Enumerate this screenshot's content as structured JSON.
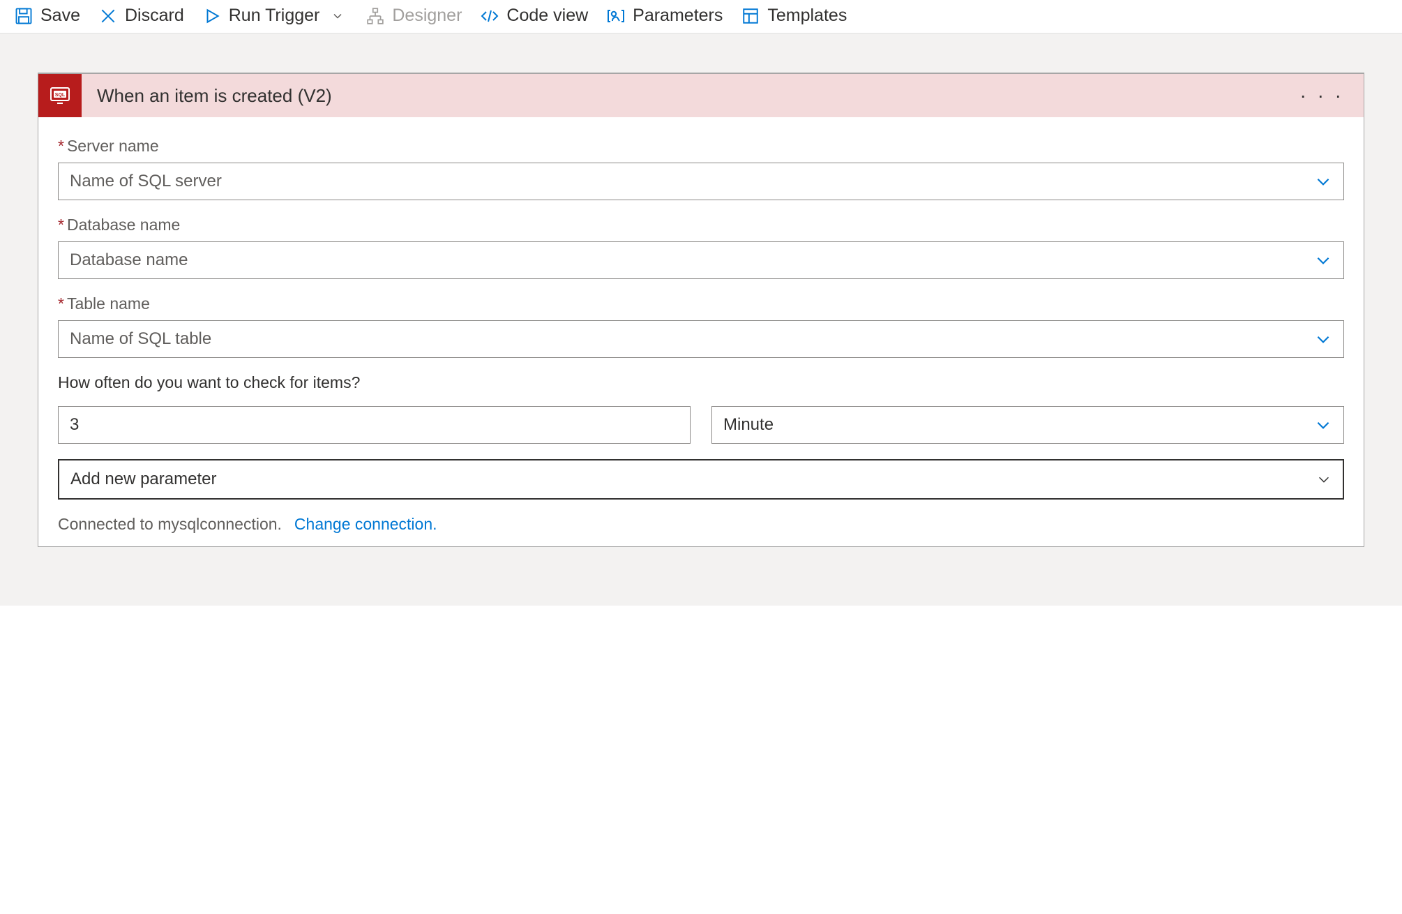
{
  "toolbar": {
    "save": "Save",
    "discard": "Discard",
    "run_trigger": "Run Trigger",
    "designer": "Designer",
    "code_view": "Code view",
    "parameters": "Parameters",
    "templates": "Templates"
  },
  "card": {
    "title": "When an item is created (V2)",
    "fields": {
      "server_name": {
        "label": "Server name",
        "placeholder": "Name of SQL server",
        "required": true
      },
      "database_name": {
        "label": "Database name",
        "placeholder": "Database name",
        "required": true
      },
      "table_name": {
        "label": "Table name",
        "placeholder": "Name of SQL table",
        "required": true
      },
      "frequency_label": "How often do you want to check for items?",
      "interval_value": "3",
      "interval_unit": "Minute",
      "add_param": "Add new parameter"
    },
    "connection": {
      "status": "Connected to mysqlconnection.",
      "change_link": "Change connection."
    }
  }
}
